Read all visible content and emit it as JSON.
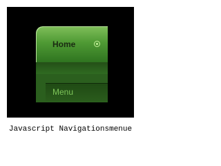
{
  "menu": {
    "home_label": "Home",
    "menu_label": "Menu",
    "colors": {
      "frame_background": "#000000",
      "home_text": "#1a2a12",
      "menu_text": "#7fc65a",
      "accent_green": "#4f9a34"
    },
    "icons": {
      "home_indicator": "radio-indicator-icon"
    }
  },
  "caption": {
    "text": "Javascript Navigationsmenue"
  }
}
